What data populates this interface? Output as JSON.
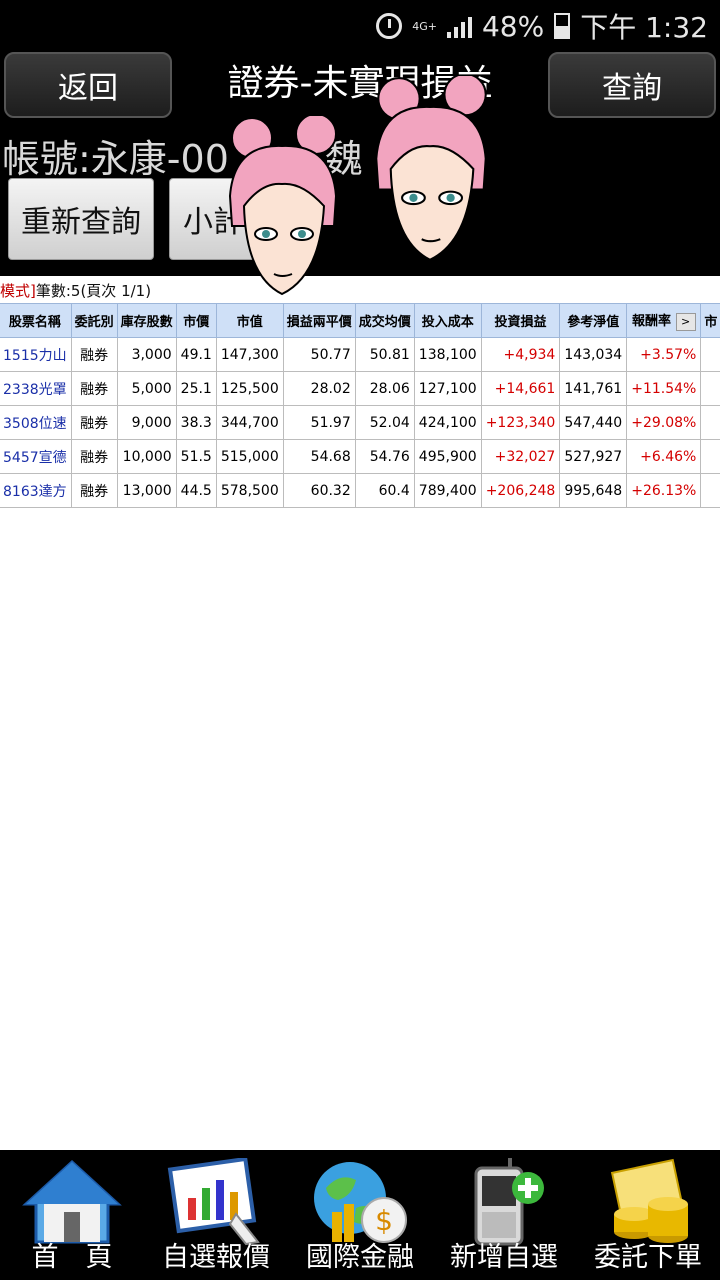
{
  "status_bar": {
    "network": "4G+",
    "battery": "48%",
    "time": "下午 1:32"
  },
  "header": {
    "back_label": "返回",
    "title": "證券-未實現損益",
    "query_label": "查詢",
    "account": "帳號:永康-00",
    "account_name": "魏",
    "requery_label": "重新查詢",
    "subtotal_label": "小計"
  },
  "summary": {
    "mode": "模式]",
    "count": "筆數:5(頁次 1/1)"
  },
  "table": {
    "columns": [
      "股票名稱",
      "委託別",
      "庫存股數",
      "市價",
      "市值",
      "損益兩平價",
      "成交均價",
      "投入成本",
      "投資損益",
      "參考淨值",
      "報酬率",
      "市"
    ],
    "more_label": ">",
    "rows": [
      {
        "name": "1515力山",
        "type": "融券",
        "shares": "3,000",
        "price": "49.1",
        "value": "147,300",
        "breakeven": "50.77",
        "avg": "50.81",
        "cost": "138,100",
        "pl": "+4,934",
        "nav": "143,034",
        "ret": "+3.57%"
      },
      {
        "name": "2338光罩",
        "type": "融券",
        "shares": "5,000",
        "price": "25.1",
        "value": "125,500",
        "breakeven": "28.02",
        "avg": "28.06",
        "cost": "127,100",
        "pl": "+14,661",
        "nav": "141,761",
        "ret": "+11.54%"
      },
      {
        "name": "3508位速",
        "type": "融券",
        "shares": "9,000",
        "price": "38.3",
        "value": "344,700",
        "breakeven": "51.97",
        "avg": "52.04",
        "cost": "424,100",
        "pl": "+123,340",
        "nav": "547,440",
        "ret": "+29.08%"
      },
      {
        "name": "5457宣德",
        "type": "融券",
        "shares": "10,000",
        "price": "51.5",
        "value": "515,000",
        "breakeven": "54.68",
        "avg": "54.76",
        "cost": "495,900",
        "pl": "+32,027",
        "nav": "527,927",
        "ret": "+6.46%"
      },
      {
        "name": "8163達方",
        "type": "融券",
        "shares": "13,000",
        "price": "44.5",
        "value": "578,500",
        "breakeven": "60.32",
        "avg": "60.4",
        "cost": "789,400",
        "pl": "+206,248",
        "nav": "995,648",
        "ret": "+26.13%"
      }
    ]
  },
  "bottom_nav": [
    {
      "label": "首　頁",
      "icon": "home-icon"
    },
    {
      "label": "自選報價",
      "icon": "chart-icon"
    },
    {
      "label": "國際金融",
      "icon": "globe-money-icon"
    },
    {
      "label": "新增自選",
      "icon": "phone-add-icon"
    },
    {
      "label": "委託下單",
      "icon": "coins-icon"
    }
  ],
  "colors": {
    "header_bg": "#000000",
    "table_header_bg": "#cfe0f7",
    "positive": "#d40000",
    "stock_name": "#1a2fa8"
  }
}
